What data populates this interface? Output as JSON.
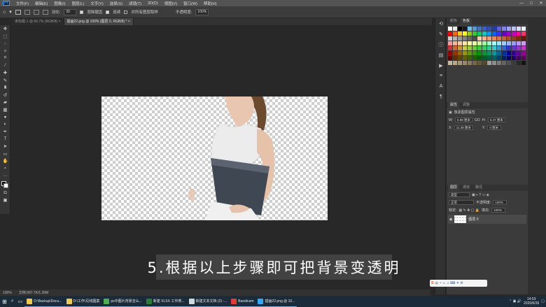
{
  "menubar": {
    "logo": "Ps",
    "items": [
      "文件(F)",
      "编辑(E)",
      "图像(I)",
      "图层(L)",
      "文字(Y)",
      "选择(S)",
      "滤镜(T)",
      "3D(D)",
      "视图(V)",
      "窗口(W)",
      "帮助(H)"
    ],
    "controls": [
      "—",
      "□",
      "✕"
    ]
  },
  "options": {
    "feather_label": "羽化:",
    "feather_value": "30",
    "antialias_label": "消除锯齿",
    "contiguous_label": "连续",
    "sample_all_label": "对所有图层取样",
    "opacity_label": "不透明度:",
    "opacity_value": "100%"
  },
  "tabs": [
    {
      "label": "未标题-1 @ 66.7% (RGB/8) ×"
    },
    {
      "label": "插画22.png @ 100% (图层 0, RGB/8) *  ×"
    }
  ],
  "document": {
    "caption": "5.根据以上步骤即可把背景变透明"
  },
  "status": {
    "zoom": "100%",
    "doc_size": "文档:997.7K/1.30M"
  },
  "swatch_panel": {
    "tabs": [
      "颜色",
      "色板"
    ],
    "colors": [
      "#ffffff",
      "#e6e6e6",
      "#000000",
      "#1a1a1a",
      "#6bc5f2",
      "#5b9bd5",
      "#4472c4",
      "#3b5fc0",
      "#2f4fb5",
      "#1f3fa5",
      "#5f5fdf",
      "#7f7fef",
      "#9f9ff5",
      "#bfbff7",
      "#ddddf9",
      "#f0f0ff",
      "#ff0000",
      "#ff6600",
      "#ffcc00",
      "#ffff00",
      "#99cc00",
      "#33cc33",
      "#00cc66",
      "#00cccc",
      "#0099ff",
      "#0066ff",
      "#3333ff",
      "#6600cc",
      "#9900cc",
      "#cc00cc",
      "#ff0099",
      "#ff3366",
      "#cccccc",
      "#b3b3b3",
      "#999999",
      "#808080",
      "#666666",
      "#4d4d4d",
      "#f8c8a8",
      "#f5b08a",
      "#f29b6c",
      "#ef864e",
      "#d9733f",
      "#c26131",
      "#ab4f23",
      "#943d15",
      "#7d2b07",
      "#661900",
      "#ff9999",
      "#ffb399",
      "#ffcc99",
      "#ffe699",
      "#ffff99",
      "#e6ff99",
      "#ccff99",
      "#99ff99",
      "#99ffcc",
      "#99ffff",
      "#99e6ff",
      "#99ccff",
      "#99b3ff",
      "#9999ff",
      "#b399ff",
      "#cc99ff",
      "#cc3333",
      "#cc6633",
      "#cc9933",
      "#cccc33",
      "#99cc33",
      "#66cc33",
      "#33cc33",
      "#33cc66",
      "#33cc99",
      "#33cccc",
      "#3399cc",
      "#3366cc",
      "#3333cc",
      "#6633cc",
      "#9933cc",
      "#cc33cc",
      "#990000",
      "#993300",
      "#996600",
      "#999900",
      "#669900",
      "#339900",
      "#009900",
      "#009933",
      "#009966",
      "#009999",
      "#006699",
      "#003399",
      "#000099",
      "#330099",
      "#660099",
      "#990099",
      "#600000",
      "#603000",
      "#604800",
      "#606000",
      "#406000",
      "#206000",
      "#006000",
      "#006020",
      "#006040",
      "#006060",
      "#004060",
      "#002060",
      "#000060",
      "#200060",
      "#400060",
      "#600060",
      "#c8b89a",
      "#b8a88a",
      "#a8987a",
      "#98886a",
      "#88785a",
      "#78684a",
      "#68583a",
      "#58482a",
      "#a0a0a0",
      "#8c8c8c",
      "#787878",
      "#646464",
      "#505050",
      "#3c3c3c",
      "#282828",
      "#141414"
    ]
  },
  "properties_panel": {
    "tabs": [
      "属性",
      "调整"
    ],
    "section": "像素图层属性",
    "w_label": "W:",
    "w_value": "5.88 厘米",
    "go_label": "GO",
    "h_label": "H:",
    "h_value": "5.47 厘米",
    "x_label": "X:",
    "x_value": "11.38 厘米",
    "y_label": "Y:",
    "y_value": "0 厘米"
  },
  "layers_panel": {
    "tabs": [
      "图层",
      "通道",
      "路径"
    ],
    "kind_label": "类型",
    "blend_mode": "正常",
    "opacity_label": "不透明度:",
    "opacity_value": "100%",
    "lock_label": "锁定:",
    "fill_label": "填充:",
    "fill_value": "100%",
    "layer_name": "图层 0"
  },
  "taskbar": {
    "tasks": [
      {
        "label": "D:\\Backup\\Docu...",
        "color": "#f2c94c"
      },
      {
        "label": "D:\\工作\\见线图案",
        "color": "#f2c94c"
      },
      {
        "label": "ps中图片背景怎么...",
        "color": "#4caf50"
      },
      {
        "label": "新建 XLSX 工作表...",
        "color": "#2e7d32"
      },
      {
        "label": "新建文本文档 (2) -...",
        "color": "#cfd8dc"
      },
      {
        "label": "Bandicam",
        "color": "#e53935"
      },
      {
        "label": "插画22.png @ 10...",
        "color": "#31a8ff"
      }
    ],
    "time": "14:53",
    "date": "2020/6/26"
  },
  "ime": {
    "label": "中"
  }
}
